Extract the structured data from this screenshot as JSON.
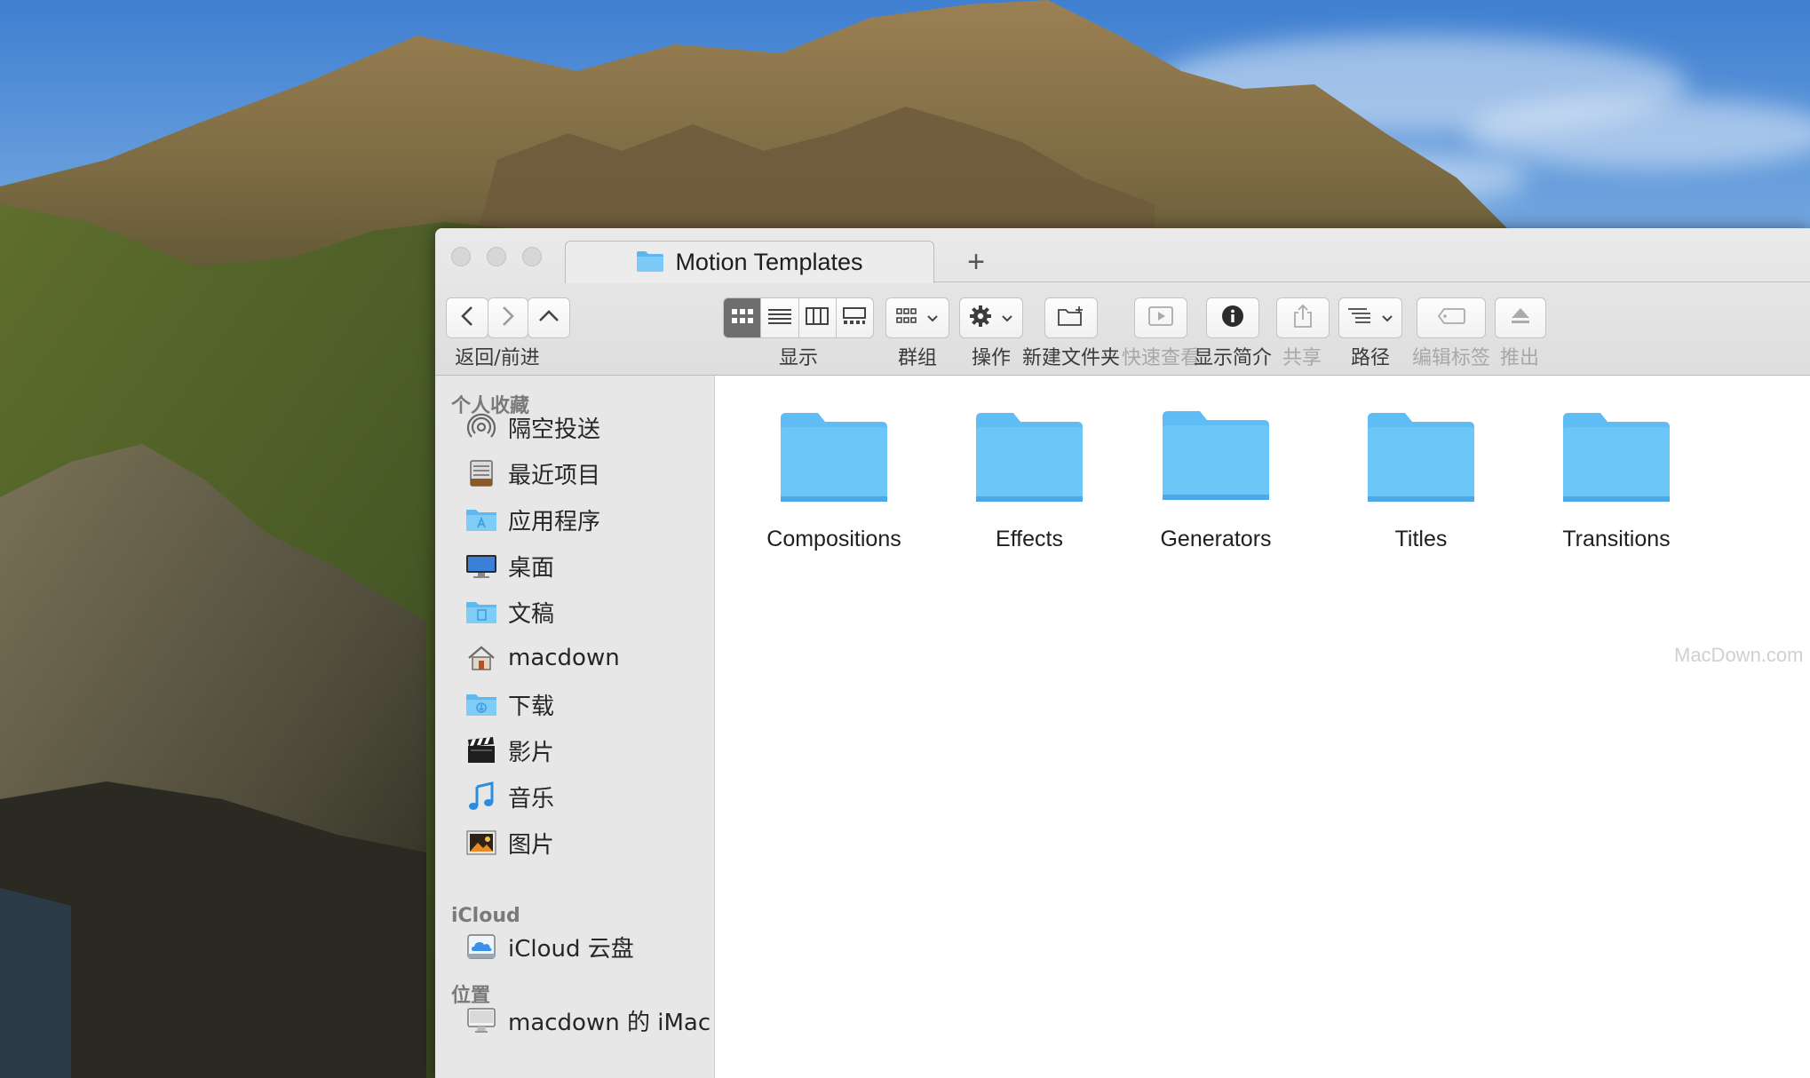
{
  "window": {
    "tab_title": "Motion Templates",
    "new_tab_symbol": "+"
  },
  "toolbar": {
    "nav_label": "返回/前进",
    "view_label": "显示",
    "group_label": "群组",
    "action_label": "操作",
    "new_folder_label": "新建文件夹",
    "quick_look_label": "快速查看",
    "get_info_label": "显示简介",
    "share_label": "共享",
    "path_label": "路径",
    "tags_label": "编辑标签",
    "eject_label": "推出"
  },
  "sidebar": {
    "favorites_header": "个人收藏",
    "favorites": [
      {
        "label": "隔空投送",
        "icon": "airdrop-icon"
      },
      {
        "label": "最近项目",
        "icon": "recents-icon"
      },
      {
        "label": "应用程序",
        "icon": "applications-folder-icon"
      },
      {
        "label": "桌面",
        "icon": "desktop-icon"
      },
      {
        "label": "文稿",
        "icon": "documents-folder-icon"
      },
      {
        "label": "macdown",
        "icon": "home-icon"
      },
      {
        "label": "下载",
        "icon": "downloads-folder-icon"
      },
      {
        "label": "影片",
        "icon": "movies-icon"
      },
      {
        "label": "音乐",
        "icon": "music-icon"
      },
      {
        "label": "图片",
        "icon": "pictures-icon"
      }
    ],
    "icloud_header": "iCloud",
    "icloud": [
      {
        "label": "iCloud 云盘",
        "icon": "icloud-drive-icon"
      }
    ],
    "locations_header": "位置",
    "locations": [
      {
        "label": "macdown 的 iMac",
        "icon": "imac-icon"
      }
    ]
  },
  "content": {
    "folders": [
      "Compositions",
      "Effects",
      "Generators",
      "Titles",
      "Transitions"
    ],
    "watermark": "MacDown.com"
  },
  "colors": {
    "folder_blue": "#66c1f5",
    "sidebar_bg": "#e7e7e7",
    "titlebar_bg": "#e4e4e4"
  }
}
